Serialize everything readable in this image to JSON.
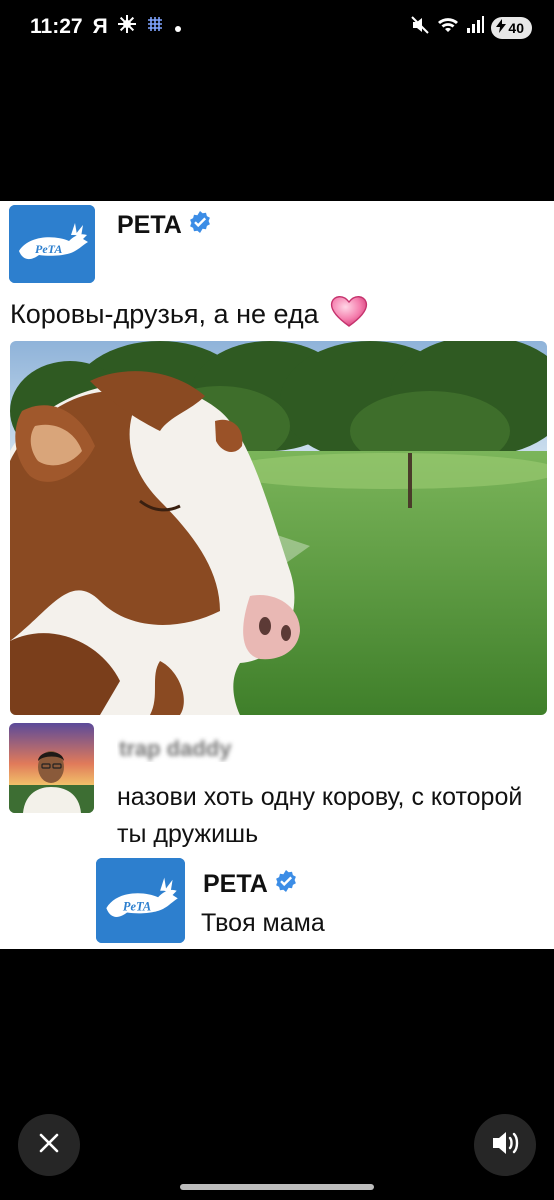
{
  "status_bar": {
    "time": "11:27",
    "app_letter": "Я",
    "battery_level": "40",
    "icons": [
      "settings-icon",
      "grid-icon",
      "mute-icon",
      "wifi-icon",
      "signal-icon",
      "battery-charging-icon"
    ]
  },
  "post": {
    "author": "PETA",
    "verified": true,
    "text": "Коровы-друзья, а не еда",
    "emoji": "💗",
    "image_subject": "cow-in-meadow"
  },
  "reply": {
    "author_blurred": "trap daddy",
    "text": "назови хоть одну корову, с которой ты дружишь"
  },
  "reply_to_reply": {
    "author": "PETA",
    "verified": true,
    "text": "Твоя мама"
  },
  "logo_text": "PeTA",
  "controls": {
    "close_icon": "close-icon",
    "sound_icon": "speaker-icon"
  },
  "colors": {
    "peta_blue": "#2d7fce",
    "verified_blue": "#3c8de6"
  }
}
